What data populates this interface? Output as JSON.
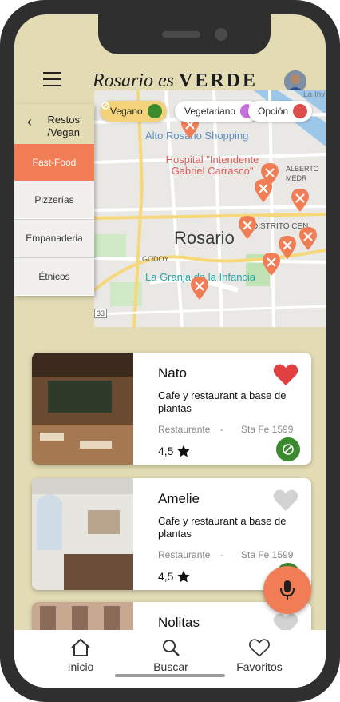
{
  "header": {
    "brand_script": "Rosario es",
    "brand_bold": "VERDE"
  },
  "filters": [
    {
      "label": "Vegano",
      "bg": "#f4d27a",
      "dot": "#3b8a2e"
    },
    {
      "label": "Vegetariano",
      "bg": "#ffffff",
      "dot": "#c86fe0"
    },
    {
      "label": "Opción",
      "bg": "#ffffff",
      "dot": "#e04d4d"
    }
  ],
  "map": {
    "labels": {
      "alto_rosario": "Alto Rosario Shopping",
      "hospital": "Hospital \"Intendente Gabriel Carrasco\"",
      "city": "Rosario",
      "granja": "La Granja de la Infancia",
      "godoy": "GODOY",
      "alberto": "ALBERTO",
      "medr": "MEDR",
      "distrito": "DISTRITO CEN",
      "la_inv": "La Inv",
      "route": "33"
    }
  },
  "sidebar": {
    "title_line1": "Restos",
    "title_line2": "/Vegan",
    "items": [
      {
        "label": "Fast-Food",
        "active": true
      },
      {
        "label": "Pizzerías",
        "active": false
      },
      {
        "label": "Empanaderia",
        "active": false
      },
      {
        "label": "Étnicos",
        "active": false
      }
    ]
  },
  "restaurants": [
    {
      "name": "Nato",
      "desc": "Cafe y restaurant a base de plantas",
      "type": "Restaurante",
      "dash": "-",
      "addr": "Sta Fe 1599",
      "rating": "4,5",
      "favorite": true
    },
    {
      "name": "Amelie",
      "desc": "Cafe y restaurant a base de plantas",
      "type": "Restaurante",
      "dash": "-",
      "addr": "Sta Fe 1599",
      "rating": "4,5",
      "favorite": false
    },
    {
      "name": "Nolitas",
      "desc": "",
      "type": "",
      "dash": "",
      "addr": "",
      "rating": "",
      "favorite": false
    }
  ],
  "tabs": [
    {
      "label": "Inicio",
      "icon": "home-icon"
    },
    {
      "label": "Buscar",
      "icon": "search-icon"
    },
    {
      "label": "Favoritos",
      "icon": "heart-icon"
    }
  ],
  "colors": {
    "background": "#e2dbb4",
    "accent": "#f07d55",
    "vegan": "#3b8a2e",
    "heart_active": "#e04040",
    "heart_inactive": "#d2d2d2"
  }
}
